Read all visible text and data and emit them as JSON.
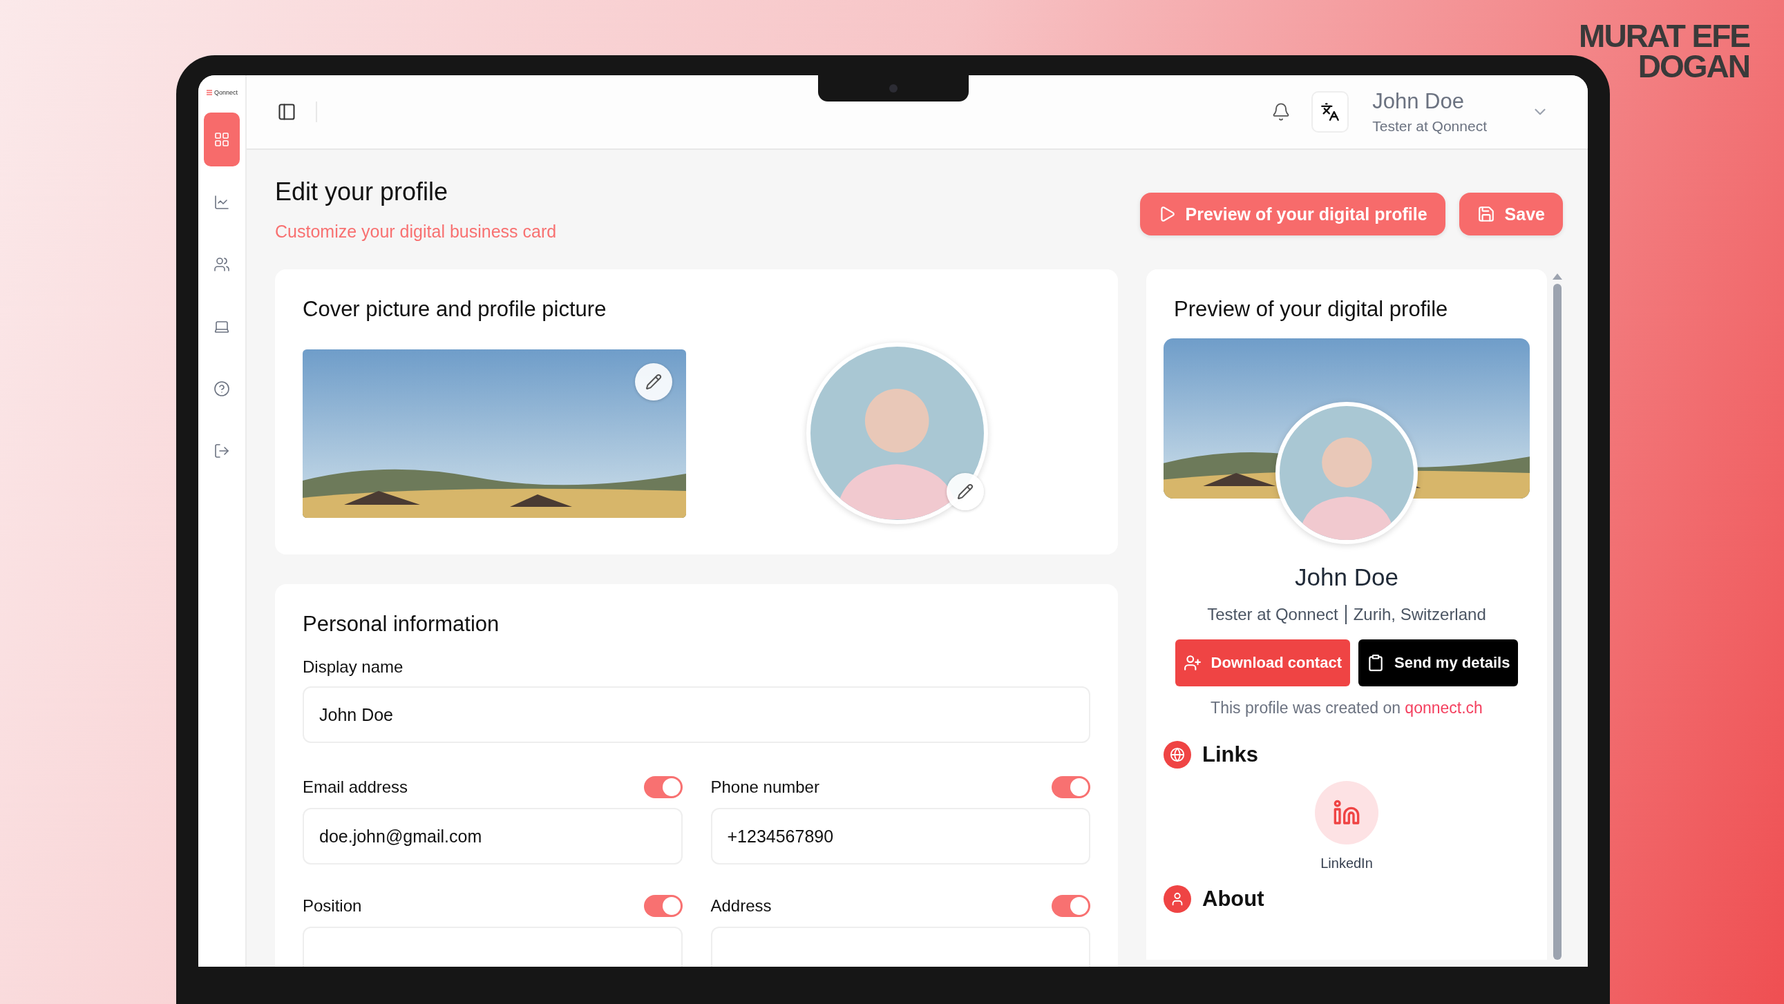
{
  "author_mark": [
    "MURAT EFE",
    "DOGAN"
  ],
  "brand": {
    "logo_text": "Qonnect"
  },
  "sidebar": {
    "items": [
      {
        "kind": "dashboard",
        "selected": true
      },
      {
        "kind": "analytics",
        "selected": false
      },
      {
        "kind": "contacts",
        "selected": false
      },
      {
        "kind": "devices",
        "selected": false
      },
      {
        "kind": "help",
        "selected": false
      },
      {
        "kind": "logout",
        "selected": false
      }
    ]
  },
  "user": {
    "name": "John Doe",
    "role": "Tester at Qonnect"
  },
  "page": {
    "title": "Edit your profile",
    "subtitle": "Customize your digital business card"
  },
  "actions": [
    {
      "kind": "preview",
      "label": "Preview of your digital profile"
    },
    {
      "kind": "save",
      "label": "Save"
    }
  ],
  "cover_card": {
    "title": "Cover picture and profile picture"
  },
  "personal_info": {
    "title": "Personal information",
    "fields": [
      {
        "label": "Display name",
        "value": "John Doe"
      },
      {
        "label": "Email address",
        "value": "doe.john@gmail.com",
        "visible": true
      },
      {
        "label": "Phone number",
        "value": "+1234567890",
        "visible": true
      },
      {
        "label": "Position",
        "visible": true
      },
      {
        "label": "Address",
        "visible": true
      }
    ]
  },
  "preview": {
    "title": "Preview of your digital profile",
    "name": "John Doe",
    "role": "Tester at Qonnect",
    "location": "Zurih, Switzerland",
    "buttons": [
      {
        "kind": "download",
        "label": "Download contact"
      },
      {
        "kind": "send",
        "label": "Send my details"
      }
    ],
    "footer": "This profile was created on",
    "link": "qonnect.ch",
    "sections": [
      {
        "kind": "links",
        "title": "Links",
        "items": [
          {
            "label": "LinkedIn"
          }
        ]
      },
      {
        "kind": "about",
        "title": "About"
      }
    ]
  }
}
